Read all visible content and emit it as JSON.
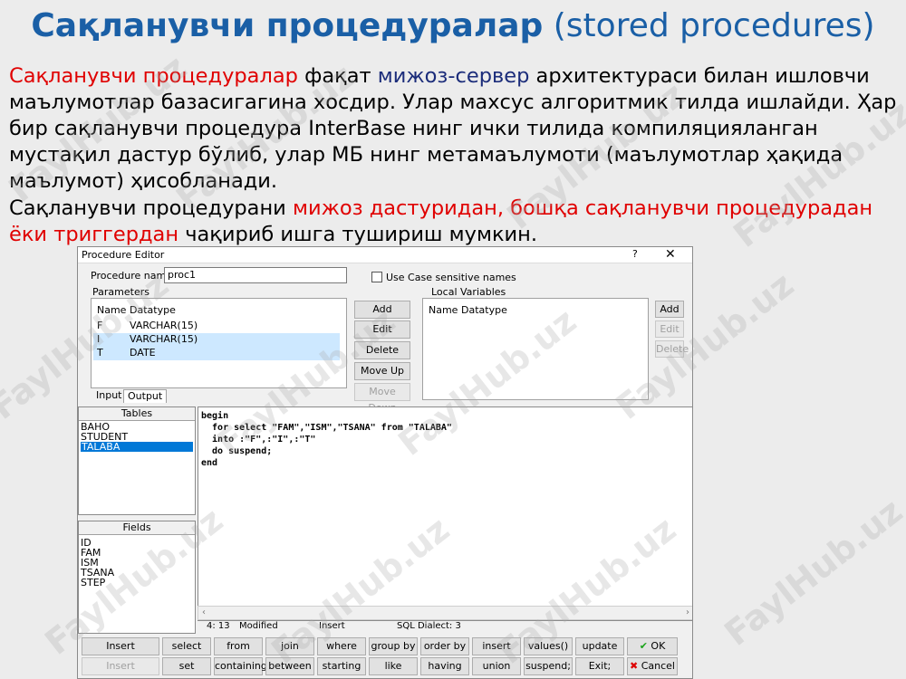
{
  "slide": {
    "title_bold": "Сақланувчи процедуралар",
    "title_rest": "(stored procedures)",
    "p1_red": "Сақланувчи процедуралар",
    "p1_a": " фақат ",
    "p1_navy": "мижоз-сервер",
    "p1_b": " архитектураси билан ишловчи маълумотлар базасигагина хосдир. Улар махсус алгоритмик тилда ишлайди. Ҳар бир  сақланувчи процедура InterBase нинг ички тилида компиляцияланган мустақил дастур бўлиб, улар МБ нинг метамаълумоти (маълумотлар ҳақида маълумот) ҳисобланади.",
    "p2_a": "Сақланувчи процедурани ",
    "p2_red": "мижоз дастуридан, бошқа сақланувчи процедурадан ёки триггердан",
    "p2_b": " чақириб ишга тушириш мумкин."
  },
  "window": {
    "title": "Procedure Editor",
    "help": "?",
    "close": "✕"
  },
  "form": {
    "procedure_name_label": "Procedure name",
    "procedure_name_value": "proc1",
    "case_sensitive_label": "Use Case sensitive names",
    "parameters_label": "Parameters",
    "local_variables_label": "Local Variables",
    "col_name": "Name",
    "col_datatype": "Datatype",
    "local_col_name": "Name",
    "local_col_datatype": "Datatype"
  },
  "parameters": [
    {
      "name": "F",
      "type": "VARCHAR(15)"
    },
    {
      "name": "I",
      "type": "VARCHAR(15)"
    },
    {
      "name": "T",
      "type": "DATE"
    }
  ],
  "param_buttons": {
    "add": "Add",
    "edit": "Edit",
    "delete": "Delete",
    "move_up": "Move Up",
    "move_down": "Move Down"
  },
  "local_buttons": {
    "add": "Add",
    "edit": "Edit",
    "delete": "Delete"
  },
  "tabs": {
    "input": "Input",
    "output": "Output"
  },
  "tables": {
    "header": "Tables",
    "items": [
      "BAHO",
      "STUDENT",
      "TALABA"
    ]
  },
  "fields": {
    "header": "Fields",
    "items": [
      "ID",
      "FAM",
      "ISM",
      "TSANA",
      "STEP"
    ]
  },
  "code": [
    "begin",
    "  for select \"FAM\",\"ISM\",\"TSANA\" from \"TALABA\"",
    "  into :\"F\",:\"I\",:\"T\"",
    "  do suspend;",
    "end"
  ],
  "status": {
    "position": "4: 13",
    "modified": "Modified",
    "mode": "Insert",
    "dialect": "SQL Dialect: 3"
  },
  "bottom_row1": [
    "Insert Tablename",
    "select",
    "from",
    "join",
    "where",
    "group by",
    "order by",
    "insert into",
    "values()",
    "update"
  ],
  "bottom_row2": [
    "Insert Fieldname",
    "set",
    "containing",
    "between",
    "starting with",
    "like",
    "having",
    "union",
    "suspend;",
    "Exit;"
  ],
  "ok_label": "OK",
  "cancel_label": "Cancel",
  "watermark": "FaylHub.uz"
}
